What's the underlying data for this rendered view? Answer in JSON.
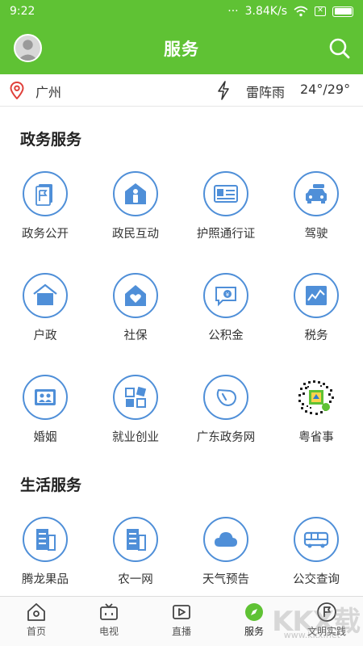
{
  "status": {
    "time": "9:22",
    "dots": "···",
    "speed": "3.84K/s",
    "sim": "✕"
  },
  "header": {
    "title": "服务"
  },
  "weather": {
    "city": "广州",
    "condition": "雷阵雨",
    "temp": "24°/29°"
  },
  "gov": {
    "title": "政务服务",
    "items": [
      {
        "label": "政务公开",
        "icon": "doc-flag-icon"
      },
      {
        "label": "政民互动",
        "icon": "house-person-icon"
      },
      {
        "label": "护照通行证",
        "icon": "id-card-icon"
      },
      {
        "label": "驾驶",
        "icon": "car-icon"
      },
      {
        "label": "户政",
        "icon": "house-icon"
      },
      {
        "label": "社保",
        "icon": "house-heart-icon"
      },
      {
        "label": "公积金",
        "icon": "chat-money-icon"
      },
      {
        "label": "税务",
        "icon": "chart-icon"
      },
      {
        "label": "婚姻",
        "icon": "couple-icon"
      },
      {
        "label": "就业创业",
        "icon": "blocks-icon"
      },
      {
        "label": "广东政务网",
        "icon": "whistle-icon"
      },
      {
        "label": "粤省事",
        "icon": "qr-code-icon"
      }
    ]
  },
  "life": {
    "title": "生活服务",
    "items": [
      {
        "label": "腾龙果品",
        "icon": "building-icon"
      },
      {
        "label": "农一网",
        "icon": "building-icon"
      },
      {
        "label": "天气预告",
        "icon": "cloud-icon"
      },
      {
        "label": "公交查询",
        "icon": "bus-icon"
      }
    ]
  },
  "tabs": [
    {
      "label": "首页",
      "icon": "home-icon"
    },
    {
      "label": "电视",
      "icon": "tv-icon"
    },
    {
      "label": "直播",
      "icon": "live-icon"
    },
    {
      "label": "服务",
      "icon": "compass-icon"
    },
    {
      "label": "文明实践",
      "icon": "flag-circle-icon"
    }
  ],
  "watermark": {
    "main": "KKX载",
    "sub": "www.kkx.net"
  },
  "colors": {
    "brand": "#5fc234",
    "icon_blue": "#4f8fd8",
    "accent_red": "#e0403a"
  }
}
